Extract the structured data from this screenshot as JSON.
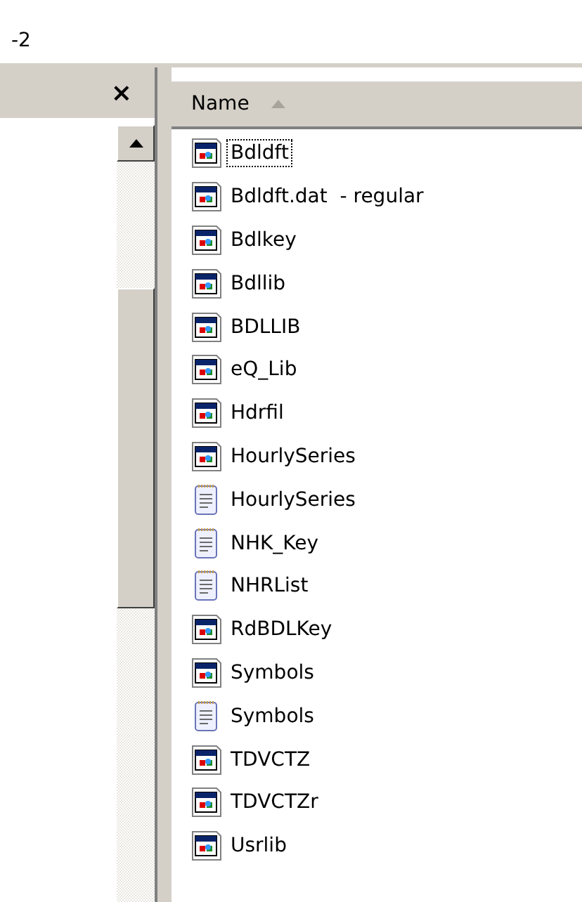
{
  "address_bar": {
    "text": "-2"
  },
  "folders_pane": {
    "close_label": "×"
  },
  "file_list": {
    "columns": [
      {
        "label": "Name",
        "sorted": true
      }
    ],
    "files": [
      {
        "name": "Bdldft",
        "kind": "app",
        "focused": true
      },
      {
        "name": "Bdldft.dat  - regular",
        "kind": "app",
        "focused": false
      },
      {
        "name": "Bdlkey",
        "kind": "app",
        "focused": false
      },
      {
        "name": "Bdllib",
        "kind": "app",
        "focused": false
      },
      {
        "name": "BDLLIB",
        "kind": "app",
        "focused": false
      },
      {
        "name": "eQ_Lib",
        "kind": "app",
        "focused": false
      },
      {
        "name": "Hdrfil",
        "kind": "app",
        "focused": false
      },
      {
        "name": "HourlySeries",
        "kind": "app",
        "focused": false
      },
      {
        "name": "HourlySeries",
        "kind": "text",
        "focused": false
      },
      {
        "name": "NHK_Key",
        "kind": "text",
        "focused": false
      },
      {
        "name": "NHRList",
        "kind": "text",
        "focused": false
      },
      {
        "name": "RdBDLKey",
        "kind": "app",
        "focused": false
      },
      {
        "name": "Symbols",
        "kind": "app",
        "focused": false
      },
      {
        "name": "Symbols",
        "kind": "text",
        "focused": false
      },
      {
        "name": "TDVCTZ",
        "kind": "app",
        "focused": false
      },
      {
        "name": "TDVCTZr",
        "kind": "app",
        "focused": false
      },
      {
        "name": "Usrlib",
        "kind": "app",
        "focused": false
      }
    ]
  }
}
